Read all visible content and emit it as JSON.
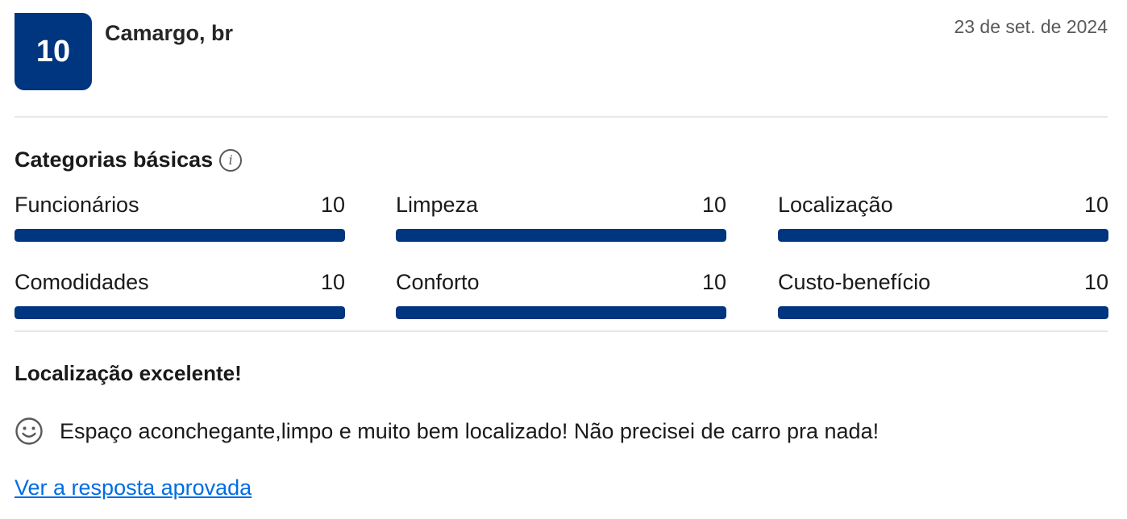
{
  "review": {
    "score": "10",
    "reviewer": "Camargo, br",
    "date": "23 de set. de 2024",
    "title": "Localização excelente!",
    "positive_text": "Espaço aconchegante,limpo e muito bem localizado! Não precisei de carro pra nada!",
    "response_link": "Ver a resposta aprovada"
  },
  "categories": {
    "title": "Categorias básicas",
    "items": [
      {
        "label": "Funcionários",
        "score": "10",
        "fill": 1.0
      },
      {
        "label": "Limpeza",
        "score": "10",
        "fill": 1.0
      },
      {
        "label": "Localização",
        "score": "10",
        "fill": 1.0
      },
      {
        "label": "Comodidades",
        "score": "10",
        "fill": 1.0
      },
      {
        "label": "Conforto",
        "score": "10",
        "fill": 1.0
      },
      {
        "label": "Custo-benefício",
        "score": "10",
        "fill": 1.0
      }
    ]
  },
  "colors": {
    "brand": "#003580",
    "link": "#006ce4",
    "divider": "#e7e7e7"
  },
  "icons": {
    "info": "info-icon",
    "positive": "smile-icon"
  }
}
